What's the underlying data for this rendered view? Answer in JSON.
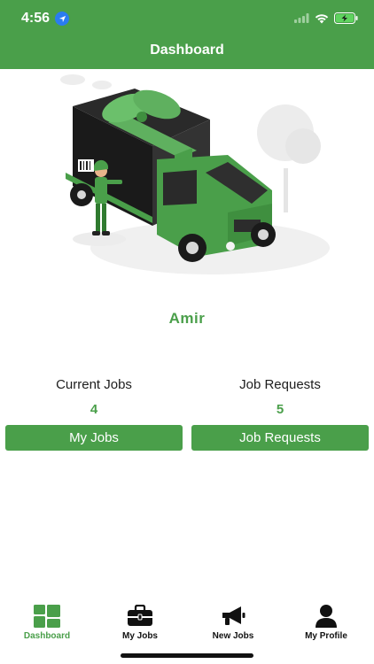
{
  "status_bar": {
    "time": "4:56"
  },
  "header": {
    "title": "Dashboard"
  },
  "user": {
    "name": "Amir"
  },
  "stats": {
    "current_jobs": {
      "label": "Current Jobs",
      "value": "4",
      "button": "My Jobs"
    },
    "job_requests": {
      "label": "Job Requests",
      "value": "5",
      "button": "Job Requests"
    }
  },
  "tabs": [
    {
      "label": "Dashboard",
      "icon": "dashboard-icon",
      "active": true
    },
    {
      "label": "My Jobs",
      "icon": "briefcase-icon",
      "active": false
    },
    {
      "label": "New Jobs",
      "icon": "megaphone-icon",
      "active": false
    },
    {
      "label": "My Profile",
      "icon": "user-icon",
      "active": false
    }
  ],
  "colors": {
    "primary": "#4a9f4a",
    "header": "#4a9f4a",
    "text": "#1d1d1d"
  }
}
